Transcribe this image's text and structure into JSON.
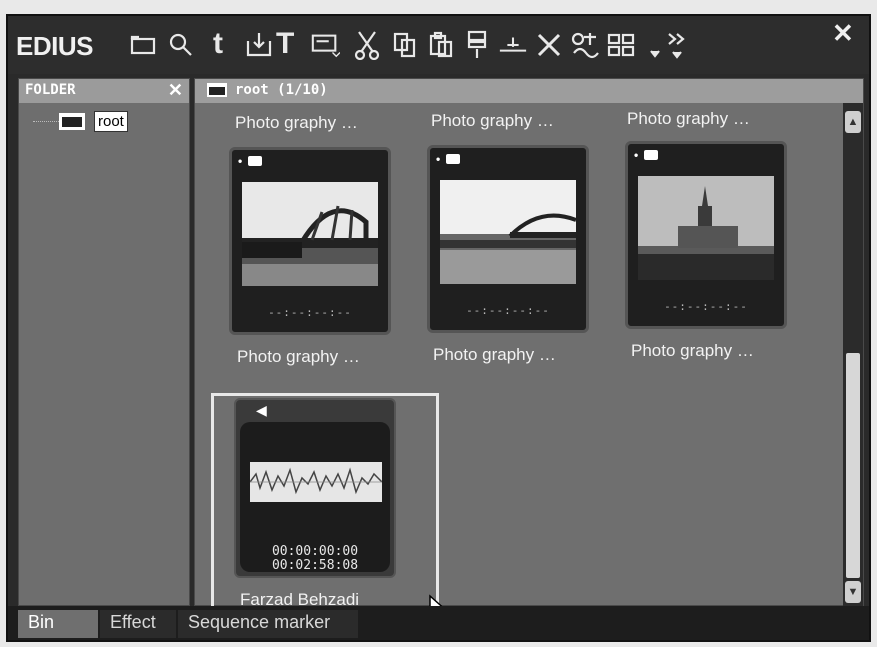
{
  "app": {
    "title": "EDIUS"
  },
  "toolbar": {
    "icons": [
      "new-folder-icon",
      "search-icon",
      "up-folder-icon",
      "import-icon",
      "title-icon",
      "clip-icon",
      "cut-icon",
      "copy-icon",
      "paste-icon",
      "add-to-timeline-icon",
      "insert-icon",
      "delete-icon",
      "properties-icon",
      "view-mode-icon",
      "more-icon"
    ],
    "text_t": "t",
    "text_T": "T",
    "close": "✕"
  },
  "folder_pane": {
    "header": "FOLDER",
    "close": "✕",
    "root_label": "root"
  },
  "bin": {
    "header": "root (1/10)",
    "top_captions": [
      "Photo graphy  …",
      "Photo graphy  …",
      "Photo graphy  …"
    ],
    "clips": [
      {
        "caption": "Photo graphy  …",
        "timecode": "--:--:--:--"
      },
      {
        "caption": "Photo graphy  …",
        "timecode": "--:--:--:--"
      },
      {
        "caption": "Photo graphy  …",
        "timecode": "--:--:--:--"
      }
    ],
    "audio_clip": {
      "caption": "Farzad Behzadi",
      "in": "00:00:00:00",
      "duration": "00:02:58:08"
    }
  },
  "tabs": [
    {
      "label": "Bin",
      "active": true
    },
    {
      "label": "Effect",
      "active": false
    },
    {
      "label": "Sequence marker",
      "active": false
    }
  ]
}
